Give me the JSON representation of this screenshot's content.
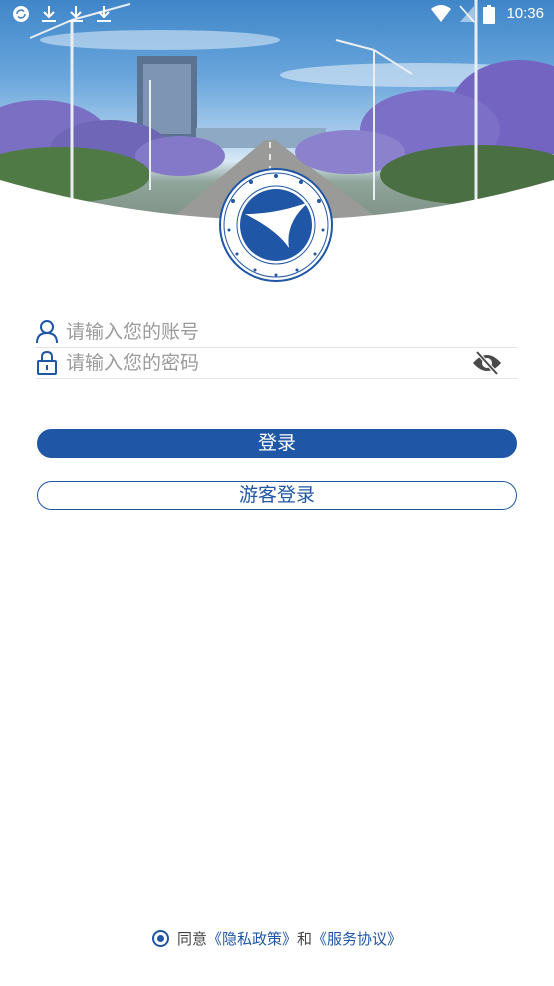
{
  "status_bar": {
    "time": "10:36",
    "left_icons": [
      "sync-icon",
      "download-icon",
      "download-icon",
      "download-icon"
    ],
    "right_icons": [
      "wifi-icon",
      "no-sim-icon",
      "battery-icon"
    ]
  },
  "colors": {
    "primary": "#1f56a5",
    "placeholder": "#9a9a9a"
  },
  "login_form": {
    "account_placeholder": "请输入您的账号",
    "account_value": "",
    "password_placeholder": "请输入您的密码",
    "password_value": "",
    "password_visibility_icon": "eye-off-icon",
    "login_label": "登录",
    "guest_login_label": "游客登录"
  },
  "agreement": {
    "agreed": true,
    "prefix": "同意",
    "privacy_policy": "《隐私政策》",
    "conjunction": "和",
    "service_agreement": "《服务协议》"
  }
}
